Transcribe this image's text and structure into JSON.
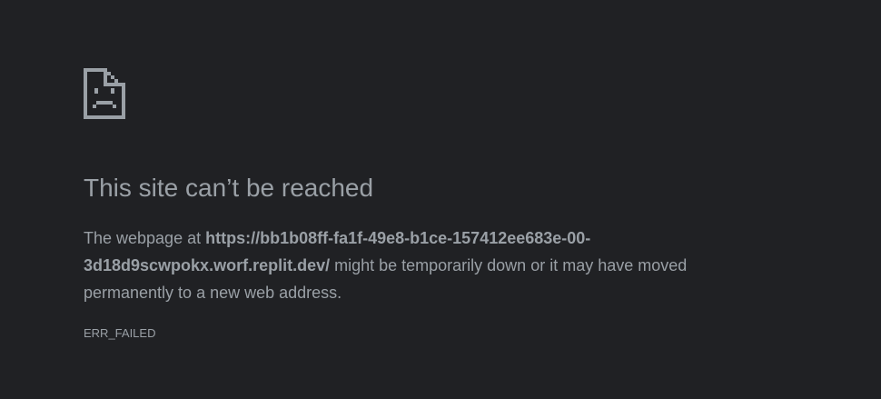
{
  "error_page": {
    "icon": "sad-page-icon",
    "title": "This site can’t be reached",
    "message": {
      "prefix": "The webpage at ",
      "url_line1": "https://bb1b08ff-fa1f-49e8-b1ce-157412ee683e-00-",
      "url_line2": "3d18d9scwpokx.worf.replit.dev/",
      "suffix": " might be temporarily down or it may have moved permanently to a new web address."
    },
    "error_code": "ERR_FAILED"
  },
  "colors": {
    "background": "#202124",
    "text": "#9aa0a6"
  }
}
